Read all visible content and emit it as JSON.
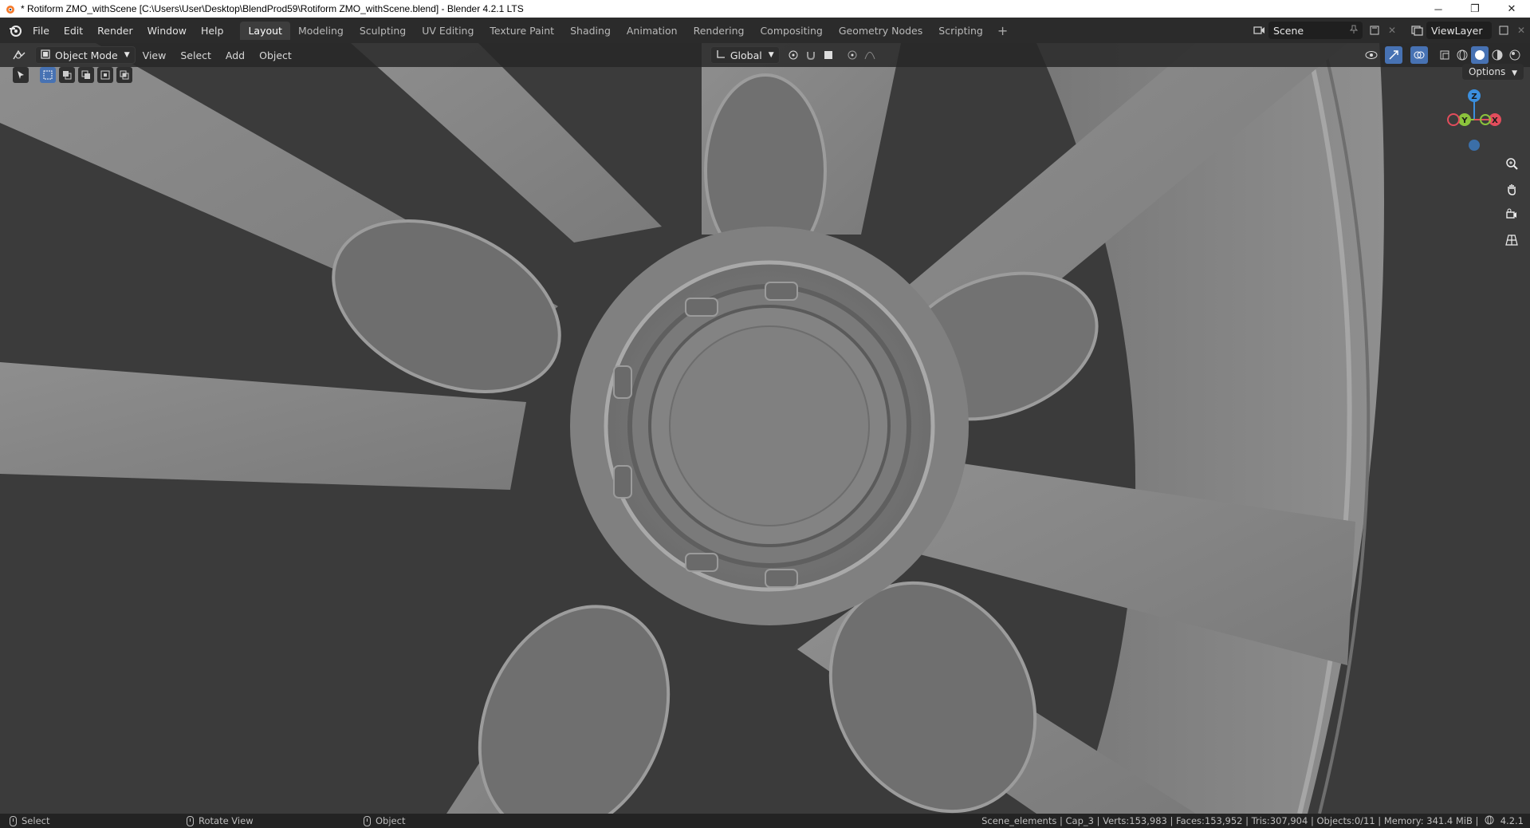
{
  "window": {
    "title": "* Rotiform ZMO_withScene [C:\\Users\\User\\Desktop\\BlendProd59\\Rotiform ZMO_withScene.blend] - Blender 4.2.1 LTS",
    "minimize_glyph": "─",
    "restore_glyph": "❐",
    "close_glyph": "✕"
  },
  "menubar": {
    "menus": [
      "File",
      "Edit",
      "Render",
      "Window",
      "Help"
    ],
    "workspace_tabs": [
      "Layout",
      "Modeling",
      "Sculpting",
      "UV Editing",
      "Texture Paint",
      "Shading",
      "Animation",
      "Rendering",
      "Compositing",
      "Geometry Nodes",
      "Scripting"
    ],
    "active_tab": "Layout",
    "add_tab_glyph": "+",
    "scene": "Scene",
    "view_layer": "ViewLayer"
  },
  "viewport_header": {
    "mode": "Object Mode",
    "menus": [
      "View",
      "Select",
      "Add",
      "Object"
    ],
    "transform_orientation": "Global",
    "options_label": "Options"
  },
  "gizmo": {
    "z": "Z",
    "y": "Y",
    "x": "X"
  },
  "statusbar": {
    "hints": [
      "Select",
      "Rotate View",
      "Object"
    ],
    "stats": "Scene_elements | Cap_3 | Verts:153,983 | Faces:153,952 | Tris:307,904 | Objects:0/11 | Memory: 341.4 MiB | ",
    "version": "4.2.1"
  },
  "colors": {
    "accent": "#4772b3",
    "active_tab": "#3d3d3d",
    "gizmo_x": "#e24d5c",
    "gizmo_y": "#8bc33c",
    "gizmo_z": "#3b8fdf"
  }
}
